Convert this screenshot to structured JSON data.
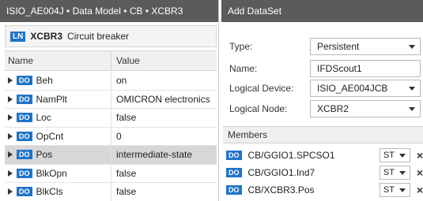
{
  "left_panel": {
    "breadcrumb": "ISIO_AE004J • Data Model • CB • XCBR3",
    "ln_badge": "LN",
    "ln_name": "XCBR3",
    "ln_description": "Circuit breaker",
    "columns": {
      "name": "Name",
      "value": "Value"
    },
    "do_badge": "DO",
    "rows": [
      {
        "name": "Beh",
        "value": "on",
        "selected": false
      },
      {
        "name": "NamPlt",
        "value": "OMICRON electronics",
        "selected": false
      },
      {
        "name": "Loc",
        "value": "false",
        "selected": false
      },
      {
        "name": "OpCnt",
        "value": "0",
        "selected": false
      },
      {
        "name": "Pos",
        "value": "intermediate-state",
        "selected": true
      },
      {
        "name": "BlkOpn",
        "value": "false",
        "selected": false
      },
      {
        "name": "BlkCls",
        "value": "false",
        "selected": false
      }
    ]
  },
  "right_panel": {
    "title": "Add DataSet",
    "type_label": "Type:",
    "type_value": "Persistent",
    "name_label": "Name:",
    "name_value": "IFDScout1",
    "logical_device_label": "Logical Device:",
    "logical_device_value": "ISIO_AE004JCB",
    "logical_node_label": "Logical Node:",
    "logical_node_value": "XCBR2",
    "members_title": "Members",
    "do_badge": "DO",
    "members": [
      {
        "path": "CB/GGIO1.SPCSO1",
        "fc": "ST",
        "remove": "×"
      },
      {
        "path": "CB/GGIO1.Ind7",
        "fc": "ST",
        "remove": "×"
      },
      {
        "path": "CB/XCBR3.Pos",
        "fc": "ST",
        "remove": "×"
      }
    ]
  },
  "colors": {
    "title_bar": "#5b5b5b",
    "badge_blue": "#1f74c9",
    "selected_row": "#d7d7d7"
  },
  "icons": {
    "expand": "triangle-right-icon",
    "dropdown": "chevron-down-icon",
    "remove": "close-icon"
  }
}
